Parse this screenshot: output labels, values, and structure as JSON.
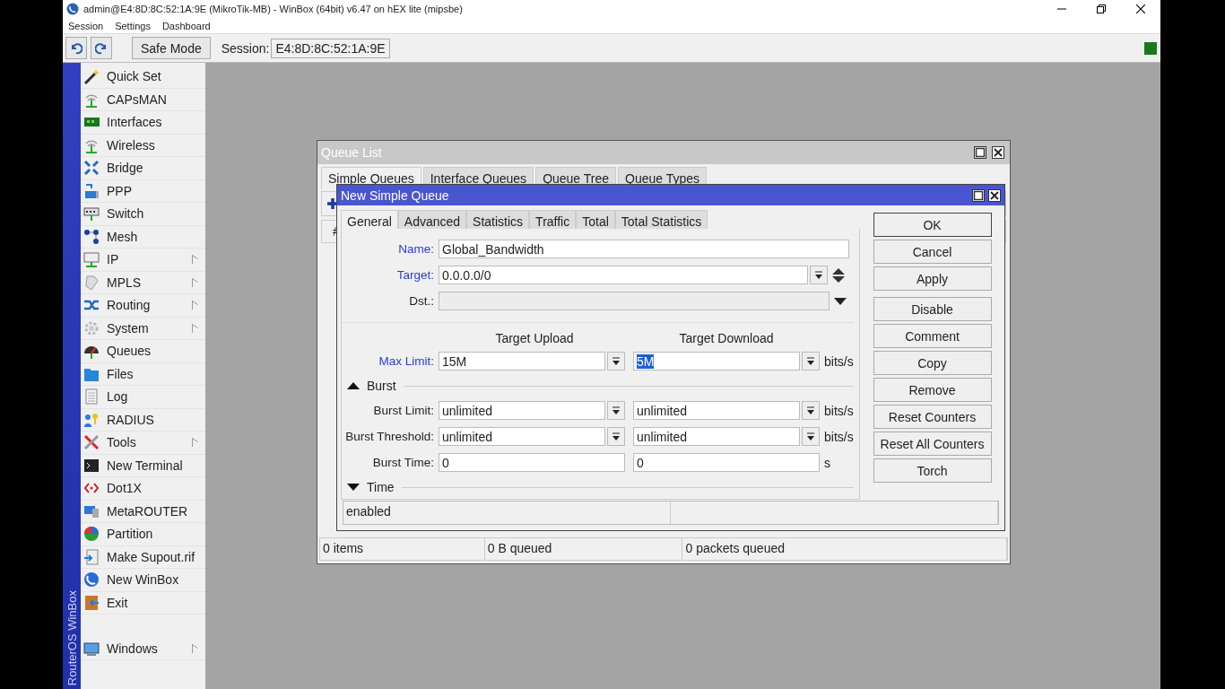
{
  "window": {
    "title": "admin@E4:8D:8C:52:1A:9E (MikroTik-MB) - WinBox (64bit) v6.47 on hEX lite (mipsbe)"
  },
  "menu": [
    "Session",
    "Settings",
    "Dashboard"
  ],
  "toolbar": {
    "safe_mode": "Safe Mode",
    "session_label": "Session:",
    "session_value": "E4:8D:8C:52:1A:9E"
  },
  "sidebar": {
    "brand": "RouterOS WinBox",
    "items": [
      {
        "label": "Quick Set",
        "submenu": false
      },
      {
        "label": "CAPsMAN",
        "submenu": false
      },
      {
        "label": "Interfaces",
        "submenu": false
      },
      {
        "label": "Wireless",
        "submenu": false
      },
      {
        "label": "Bridge",
        "submenu": false
      },
      {
        "label": "PPP",
        "submenu": false
      },
      {
        "label": "Switch",
        "submenu": false
      },
      {
        "label": "Mesh",
        "submenu": false
      },
      {
        "label": "IP",
        "submenu": true
      },
      {
        "label": "MPLS",
        "submenu": true
      },
      {
        "label": "Routing",
        "submenu": true
      },
      {
        "label": "System",
        "submenu": true
      },
      {
        "label": "Queues",
        "submenu": false
      },
      {
        "label": "Files",
        "submenu": false
      },
      {
        "label": "Log",
        "submenu": false
      },
      {
        "label": "RADIUS",
        "submenu": false
      },
      {
        "label": "Tools",
        "submenu": true
      },
      {
        "label": "New Terminal",
        "submenu": false
      },
      {
        "label": "Dot1X",
        "submenu": false
      },
      {
        "label": "MetaROUTER",
        "submenu": false
      },
      {
        "label": "Partition",
        "submenu": false
      },
      {
        "label": "Make Supout.rif",
        "submenu": false
      },
      {
        "label": "New WinBox",
        "submenu": false
      },
      {
        "label": "Exit",
        "submenu": false
      }
    ],
    "bottom_items": [
      {
        "label": "Windows",
        "submenu": true
      }
    ]
  },
  "queue_list": {
    "title": "Queue List",
    "tabs": [
      {
        "label": "Simple Queues",
        "selected": true
      },
      {
        "label": "Interface Queues",
        "selected": false
      },
      {
        "label": "Queue Tree",
        "selected": false
      },
      {
        "label": "Queue Types",
        "selected": false
      }
    ],
    "column_1": "#",
    "status": [
      "0 items",
      "0 B queued",
      "0 packets queued"
    ]
  },
  "dialog": {
    "title": "New Simple Queue",
    "tabs": [
      {
        "label": "General",
        "selected": true
      },
      {
        "label": "Advanced",
        "selected": false
      },
      {
        "label": "Statistics",
        "selected": false
      },
      {
        "label": "Traffic",
        "selected": false
      },
      {
        "label": "Total",
        "selected": false
      },
      {
        "label": "Total Statistics",
        "selected": false
      }
    ],
    "fields": [
      {
        "kind": "text",
        "label": "Name:",
        "value": "Global_Bandwidth",
        "highlight": true
      },
      {
        "kind": "updown",
        "label": "Target:",
        "value": "0.0.0.0/0",
        "highlight": true
      },
      {
        "kind": "disabled",
        "label": "Dst.:",
        "highlight": false
      }
    ],
    "column_headers": [
      "Target Upload",
      "Target Download"
    ],
    "rows": [
      {
        "kind": "limit",
        "label": "Max Limit:",
        "highlight": true,
        "upload": "15M",
        "download": "5M",
        "download_selected": true,
        "unit": "bits/s"
      },
      {
        "kind": "section",
        "label": "Burst",
        "expanded": true
      },
      {
        "kind": "limit",
        "label": "Burst Limit:",
        "highlight": false,
        "upload": "unlimited",
        "download": "unlimited",
        "download_selected": false,
        "unit": "bits/s"
      },
      {
        "kind": "limit",
        "label": "Burst Threshold:",
        "highlight": false,
        "upload": "unlimited",
        "download": "unlimited",
        "download_selected": false,
        "unit": "bits/s"
      },
      {
        "kind": "plain",
        "label": "Burst Time:",
        "highlight": false,
        "upload": "0",
        "download": "0",
        "download_selected": false,
        "unit": "s"
      },
      {
        "kind": "section",
        "label": "Time",
        "expanded": false
      }
    ],
    "buttons": [
      {
        "label": "OK",
        "default": true
      },
      {
        "label": "Cancel",
        "default": false
      },
      {
        "label": "Apply",
        "default": false
      },
      {
        "label": "Disable",
        "default": false
      },
      {
        "label": "Comment",
        "default": false
      },
      {
        "label": "Copy",
        "default": false
      },
      {
        "label": "Remove",
        "default": false
      },
      {
        "label": "Reset Counters",
        "default": false
      },
      {
        "label": "Reset All Counters",
        "default": false
      },
      {
        "label": "Torch",
        "default": false
      }
    ],
    "status": "enabled"
  }
}
